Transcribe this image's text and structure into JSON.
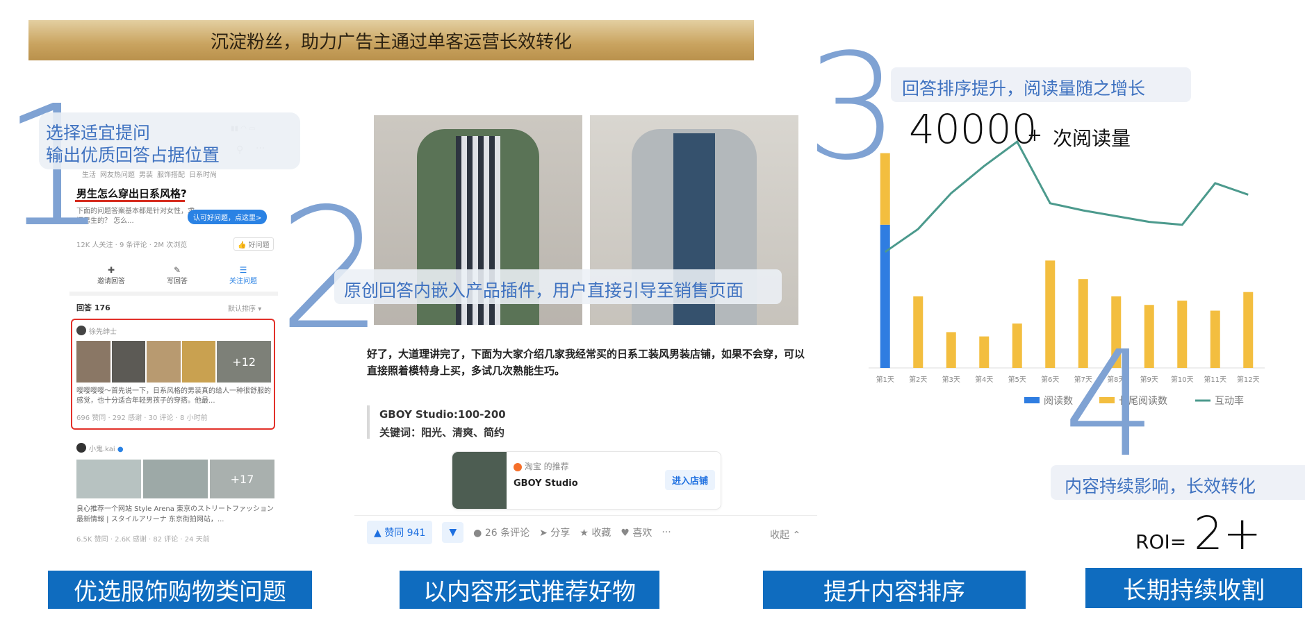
{
  "banner": {
    "text": "沉淀粉丝，助力广告主通过单客运营长效转化"
  },
  "steps": [
    {
      "number": "1",
      "note_line1": "选择适宜提问",
      "note_line2": "输出优质回答占据位置",
      "label": "优选服饰购物类问题"
    },
    {
      "number": "2",
      "note": "原创回答内嵌入产品插件，用户直接引导至销售页面",
      "label": "以内容形式推荐好物"
    },
    {
      "number": "3",
      "note": "回答排序提升，阅读量随之增长",
      "label": "提升内容排序"
    },
    {
      "number": "4",
      "note": "内容持续影响，长效转化",
      "label": "长期持续收割"
    }
  ],
  "metrics": {
    "reads_number": "40000",
    "reads_plus": "+",
    "reads_label": "次阅读量",
    "roi_prefix": "ROI=",
    "roi_value": "2+"
  },
  "phone": {
    "tags": [
      "生活",
      "网友热问题",
      "男装",
      "服饰搭配",
      "日系时尚"
    ],
    "question_title": "男生怎么穿出日系风格?",
    "question_excerpt": "下面的问题答案基本都是针对女性，求问男生的？ 怎么...",
    "tooltip": "认可好问题，点这里>",
    "stats": "12K 人关注 · 9 条评论 · 2M 次浏览",
    "good_question": "好问题",
    "actions": [
      "邀请回答",
      "写回答",
      "关注问题"
    ],
    "answers_header": "回答 176",
    "sort_label": "默认排序",
    "answer1": {
      "author": "徐先绅士",
      "more_images": "+12",
      "excerpt": "嘤嘤嘤嘤～首先说一下，日系风格的男装真的给人一种很舒服的感觉，也十分适合年轻男孩子的穿搭。他最...",
      "meta": "696 赞同 · 292 感谢 · 30 评论 · 8 小时前"
    },
    "answer2": {
      "author": "小鬼.kai",
      "more_images": "+17",
      "excerpt": "良心推荐一个网站 Style Arena 東京のストリートファッション最新情報 | スタイルアリーナ 东京街拍网站，...",
      "meta": "6.5K 赞同 · 2.6K 感谢 · 82 评论 · 24 天前"
    }
  },
  "article": {
    "paragraph": "好了，大道理讲完了，下面为大家介绍几家我经常买的日系工装风男装店铺，如果不会穿，可以直接照着模特身上买，多试几次熟能生巧。",
    "quote_line1": "GBOY Studio:100-200",
    "quote_line2": "关键词：阳光、清爽、简约",
    "product_source": "淘宝 的推荐",
    "product_name": "GBOY Studio",
    "product_button": "进入店铺",
    "toolbar": {
      "upvote": "▲ 赞同 941",
      "comments": "26 条评论",
      "share": "分享",
      "favorite": "收藏",
      "like": "喜欢",
      "more": "···",
      "collapse": "收起"
    }
  },
  "colors": {
    "blue": "#2f7de1",
    "yellow": "#f3be3f",
    "teal": "#4c9a8d",
    "accent_blue": "#0f6cbf"
  },
  "chart_data": {
    "type": "bar",
    "categories": [
      "第1天",
      "第2天",
      "第3天",
      "第4天",
      "第5天",
      "第6天",
      "第7天",
      "第8天",
      "第9天",
      "第10天",
      "第11天",
      "第12天"
    ],
    "series": [
      {
        "name": "阅读数",
        "type": "bar",
        "values": [
          100,
          0,
          0,
          0,
          0,
          0,
          0,
          0,
          0,
          0,
          0,
          0
        ]
      },
      {
        "name": "长尾阅读数",
        "type": "bar",
        "values": [
          50,
          50,
          25,
          22,
          31,
          75,
          62,
          50,
          44,
          47,
          40,
          53
        ]
      },
      {
        "name": "互动率",
        "type": "line",
        "values": [
          81,
          97,
          122,
          141,
          158,
          115,
          110,
          106,
          102,
          100,
          129,
          121
        ]
      }
    ],
    "ylim": [
      0,
      160
    ],
    "legend_position": "bottom",
    "grid": false
  }
}
